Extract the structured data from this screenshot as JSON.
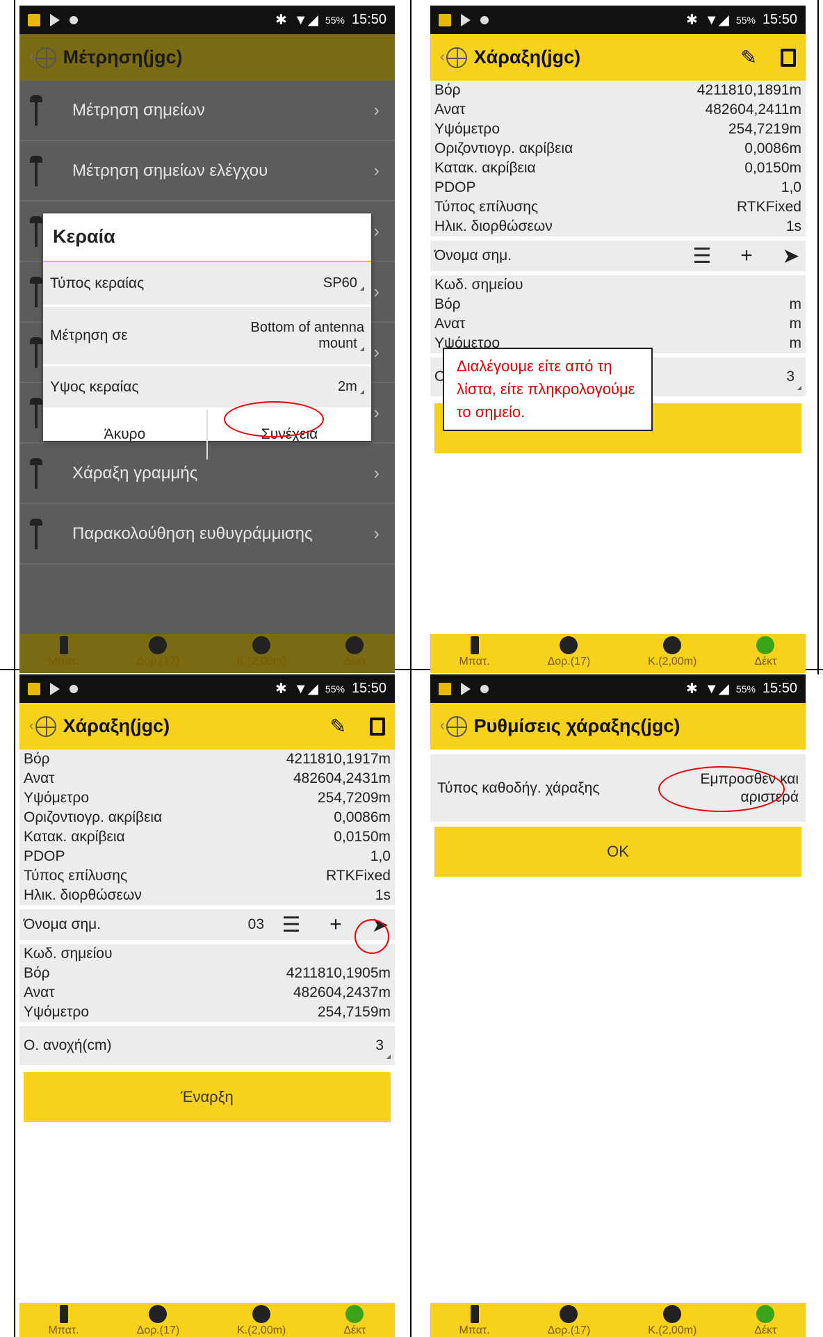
{
  "statusbar": {
    "battery_pct": "55%",
    "time": "15:50"
  },
  "bottombar": [
    {
      "label": "Μπατ.",
      "icon": "battery-icon"
    },
    {
      "label": "Δορ.(17)",
      "icon": "satellite-icon"
    },
    {
      "label": "Κ.(2,00m)",
      "icon": "base-icon"
    },
    {
      "label": "Δέκτ",
      "icon": "receiver-icon"
    }
  ],
  "screen1": {
    "title": "Μέτρηση(jgc)",
    "menu": [
      "Μέτρηση σημείων",
      "Μέτρηση σημείων ελέγχου",
      "",
      "",
      "",
      "",
      "Χάραξη γραμμής",
      "Παρακολούθηση ευθυγράμμισης"
    ],
    "dialog": {
      "title": "Κεραία",
      "rows": [
        {
          "label": "Τύπος κεραίας",
          "value": "SP60"
        },
        {
          "label": "Μέτρηση σε",
          "value": "Bottom of antenna mount"
        },
        {
          "label": "Υψος κεραίας",
          "value": "2m"
        }
      ],
      "cancel": "Άκυρο",
      "continue": "Συνέχεια"
    }
  },
  "screen2": {
    "title": "Χάραξη(jgc)",
    "rows": [
      {
        "label": "Βόρ",
        "value": "4211810,1891m"
      },
      {
        "label": "Ανατ",
        "value": "482604,2411m"
      },
      {
        "label": "Υψόμετρο",
        "value": "254,7219m"
      },
      {
        "label": "Οριζοντιογρ. ακρίβεια",
        "value": "0,0086m"
      },
      {
        "label": "Κατακ. ακρίβεια",
        "value": "0,0150m"
      },
      {
        "label": "PDOP",
        "value": "1,0"
      },
      {
        "label": "Τύπος επίλυσης",
        "value": "RTKFixed"
      },
      {
        "label": "Ηλικ. διορθώσεων",
        "value": "1s"
      }
    ],
    "point_name_label": "Όνομα σημ.",
    "point_name_value": "",
    "rows2": [
      {
        "label": "Κωδ. σημείου",
        "value": ""
      },
      {
        "label": "Βόρ",
        "value": "m"
      },
      {
        "label": "Ανατ",
        "value": "m"
      },
      {
        "label": "Υψόμετρο",
        "value": "m"
      }
    ],
    "tolerance_label": "Ο",
    "tolerance_value": "3",
    "start_button": "",
    "callout": "Διαλέγουμε είτε από τη λίστα, είτε πληκρολογούμε το σημείο."
  },
  "screen3": {
    "title": "Χάραξη(jgc)",
    "rows": [
      {
        "label": "Βόρ",
        "value": "4211810,1917m"
      },
      {
        "label": "Ανατ",
        "value": "482604,2431m"
      },
      {
        "label": "Υψόμετρο",
        "value": "254,7209m"
      },
      {
        "label": "Οριζοντιογρ. ακρίβεια",
        "value": "0,0086m"
      },
      {
        "label": "Κατακ. ακρίβεια",
        "value": "0,0150m"
      },
      {
        "label": "PDOP",
        "value": "1,0"
      },
      {
        "label": "Τύπος επίλυσης",
        "value": "RTKFixed"
      },
      {
        "label": "Ηλικ. διορθώσεων",
        "value": "1s"
      }
    ],
    "point_name_label": "Όνομα σημ.",
    "point_name_value": "03",
    "rows2": [
      {
        "label": "Κωδ. σημείου",
        "value": ""
      },
      {
        "label": "Βόρ",
        "value": "4211810,1905m"
      },
      {
        "label": "Ανατ",
        "value": "482604,2437m"
      },
      {
        "label": "Υψόμετρο",
        "value": "254,7159m"
      }
    ],
    "tolerance_label": "Ο. ανοχή(cm)",
    "tolerance_value": "3",
    "start_button": "Έναρξη"
  },
  "screen4": {
    "title": "Ρυθμίσεις χάραξης(jgc)",
    "setting_label": "Τύπος καθοδήγ. χάραξης",
    "setting_value_line1": "Εμπροσθεν και",
    "setting_value_line2": "αριστερά",
    "ok_button": "OK"
  }
}
